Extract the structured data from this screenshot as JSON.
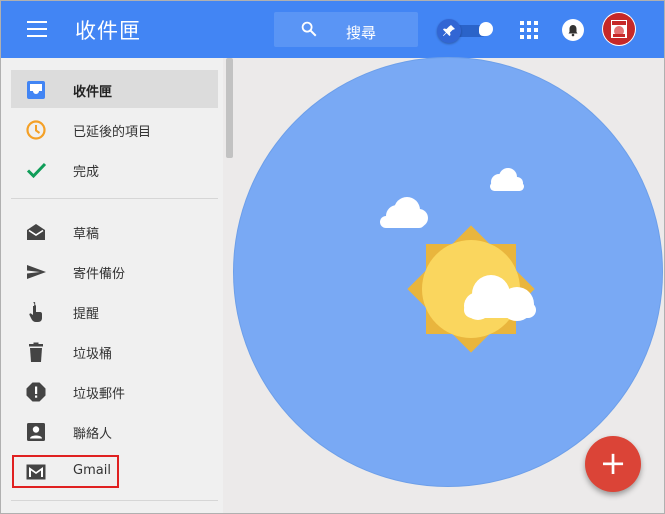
{
  "header": {
    "title": "收件匣",
    "search_label": "搜尋"
  },
  "sidebar": {
    "items": [
      {
        "label": "收件匣"
      },
      {
        "label": "已延後的項目"
      },
      {
        "label": "完成"
      },
      {
        "label": "草稿"
      },
      {
        "label": "寄件備份"
      },
      {
        "label": "提醒"
      },
      {
        "label": "垃圾桶"
      },
      {
        "label": "垃圾郵件"
      },
      {
        "label": "聯絡人"
      },
      {
        "label": "Gmail"
      }
    ]
  },
  "fab": {
    "label": "+"
  },
  "colors": {
    "header": "#4285f4",
    "accent_blue": "#4285f4",
    "snooze_orange": "#f4a026",
    "done_green": "#0f9d58",
    "fab_red": "#db4437",
    "empty_state_circle": "#79a9f4"
  },
  "icons": {
    "menu": "hamburger-icon",
    "search": "search-icon",
    "pin": "pin-icon",
    "apps": "apps-grid-icon",
    "notifications": "bell-icon",
    "inbox": "inbox-icon",
    "snoozed": "clock-icon",
    "done": "checkmark-icon",
    "drafts": "drafts-icon",
    "sent": "send-icon",
    "reminders": "reminder-finger-icon",
    "trash": "trash-icon",
    "spam": "spam-icon",
    "contacts": "contacts-icon",
    "gmail": "gmail-icon"
  }
}
